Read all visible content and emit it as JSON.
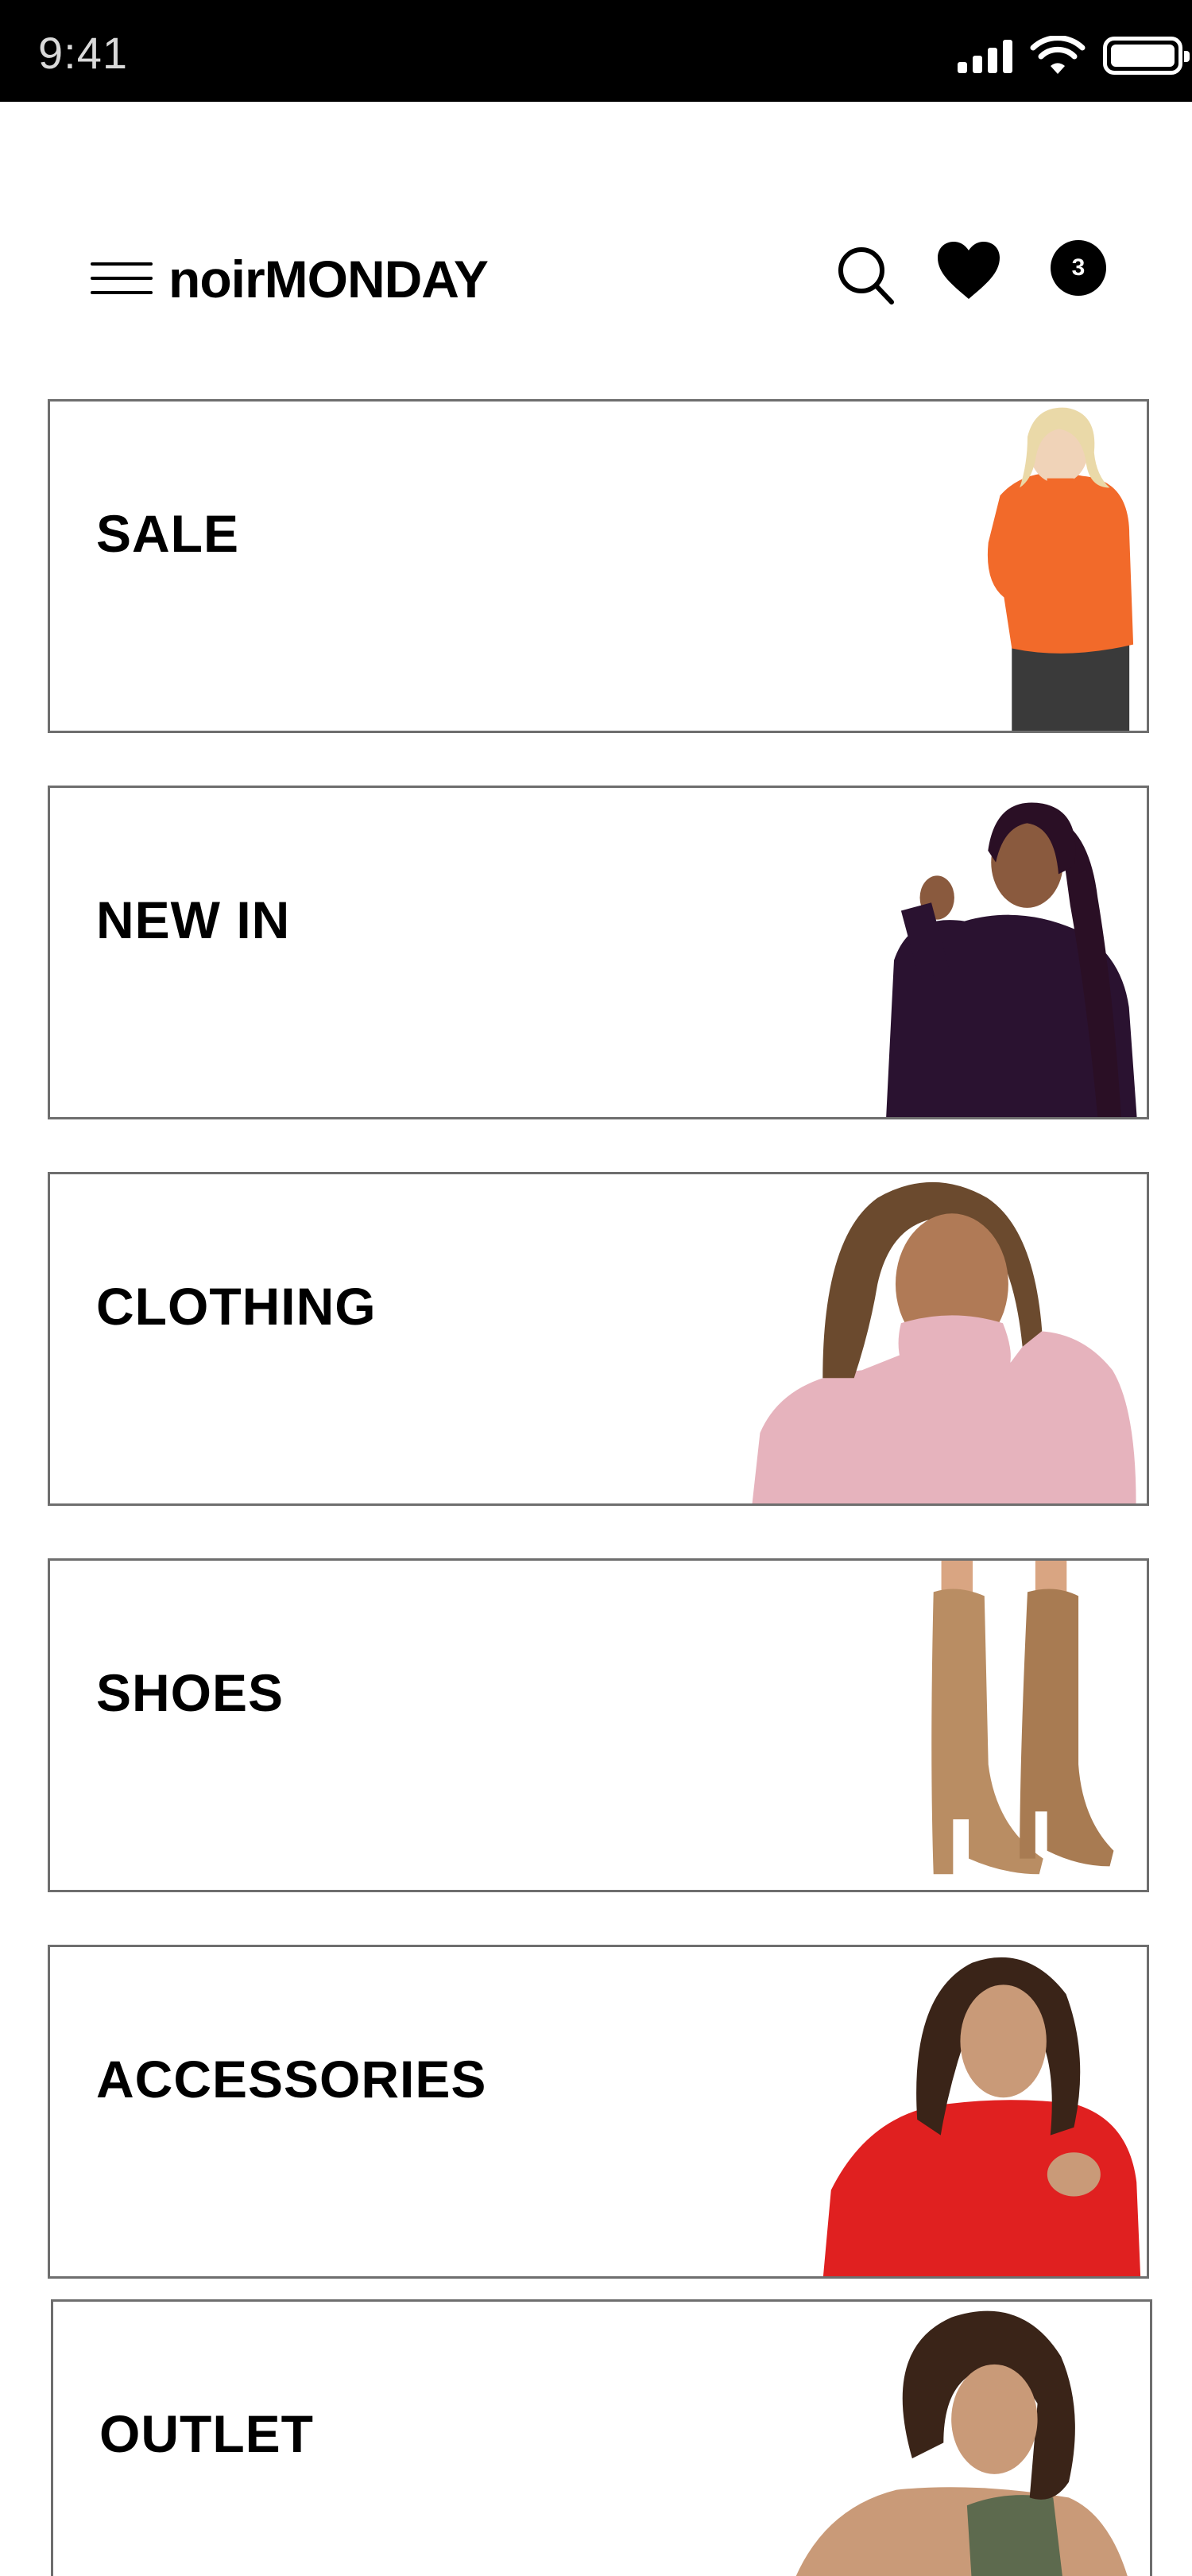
{
  "status_bar": {
    "time": "9:41"
  },
  "header": {
    "logo_light": "noir",
    "logo_bold": "MONDAY",
    "cart_count": "3"
  },
  "categories": [
    {
      "label": "SALE",
      "image": "model-orange-sweater"
    },
    {
      "label": "NEW IN",
      "image": "model-black-top"
    },
    {
      "label": "CLOTHING",
      "image": "model-pink-knit"
    },
    {
      "label": "SHOES",
      "image": "tan-knee-boots"
    },
    {
      "label": "ACCESSORIES",
      "image": "model-red-sweater"
    },
    {
      "label": "OUTLET",
      "image": "model-olive-sports-bra"
    }
  ],
  "colors": {
    "orange_sweater": "#f26a2a",
    "black_top": "#2a1230",
    "pink_knit": "#e6b3bd",
    "boots_tan": "#b98d63",
    "red_sweater": "#e02020",
    "olive_top": "#5d6a4e"
  }
}
